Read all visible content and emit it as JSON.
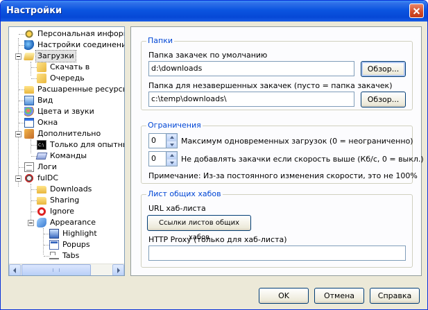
{
  "window": {
    "title": "Настройки"
  },
  "tree": {
    "items": [
      {
        "label": "Персональная информац",
        "icon": "gear-icon"
      },
      {
        "label": "Настройки соединения",
        "icon": "globe-icon"
      },
      {
        "label": "Загрузки",
        "icon": "folder-open-icon"
      },
      {
        "label": "Скачать в",
        "icon": "folder-icon"
      },
      {
        "label": "Очередь",
        "icon": "folder-icon"
      },
      {
        "label": "Расшаренные ресурсы",
        "icon": "folder-icon"
      },
      {
        "label": "Вид",
        "icon": "view-icon"
      },
      {
        "label": "Цвета и звуки",
        "icon": "palette-icon"
      },
      {
        "label": "Окна",
        "icon": "window-icon"
      },
      {
        "label": "Дополнительно",
        "icon": "advanced-icon"
      },
      {
        "label": "Только для опытных",
        "icon": "cmd-icon"
      },
      {
        "label": "Команды",
        "icon": "commands-icon"
      },
      {
        "label": "Логи",
        "icon": "log-icon"
      },
      {
        "label": "fulDC",
        "icon": "fuldc-icon"
      },
      {
        "label": "Downloads",
        "icon": "folder-icon"
      },
      {
        "label": "Sharing",
        "icon": "folder-icon"
      },
      {
        "label": "Ignore",
        "icon": "ignore-icon"
      },
      {
        "label": "Appearance",
        "icon": "appearance-icon"
      },
      {
        "label": "Highlight",
        "icon": "highlight-icon"
      },
      {
        "label": "Popups",
        "icon": "popups-icon"
      },
      {
        "label": "Tabs",
        "icon": "tabs-icon"
      }
    ],
    "selected": "Загрузки"
  },
  "folders": {
    "title": "Папки",
    "default_label": "Папка закачек по умолчанию",
    "default_value": "d:\\downloads",
    "browse1": "Обзор...",
    "incomplete_label": "Папка для незавершенных закачек (пусто = папка закачек)",
    "incomplete_value": "c:\\temp\\downloads\\",
    "browse2": "Обзор..."
  },
  "limits": {
    "title": "Ограничения",
    "max_downloads_value": "0",
    "max_downloads_label": "Максимум одновременных загрузок (0 = неограниченно)",
    "speed_value": "0",
    "speed_label": "Не добавлять закачки если скорость выше (Кб/с, 0 = выкл.)",
    "note": "Примечание: Из-за постоянного изменения скорости, это не 100%"
  },
  "hublist": {
    "title": "Лист общих хабов",
    "url_label": "URL хаб-листа",
    "links_button": "Ссылки листов общих хабов",
    "proxy_label": "HTTP Proxy (только для хаб-листа)",
    "proxy_value": ""
  },
  "footer": {
    "ok": "OK",
    "cancel": "Отмена",
    "help": "Справка"
  }
}
